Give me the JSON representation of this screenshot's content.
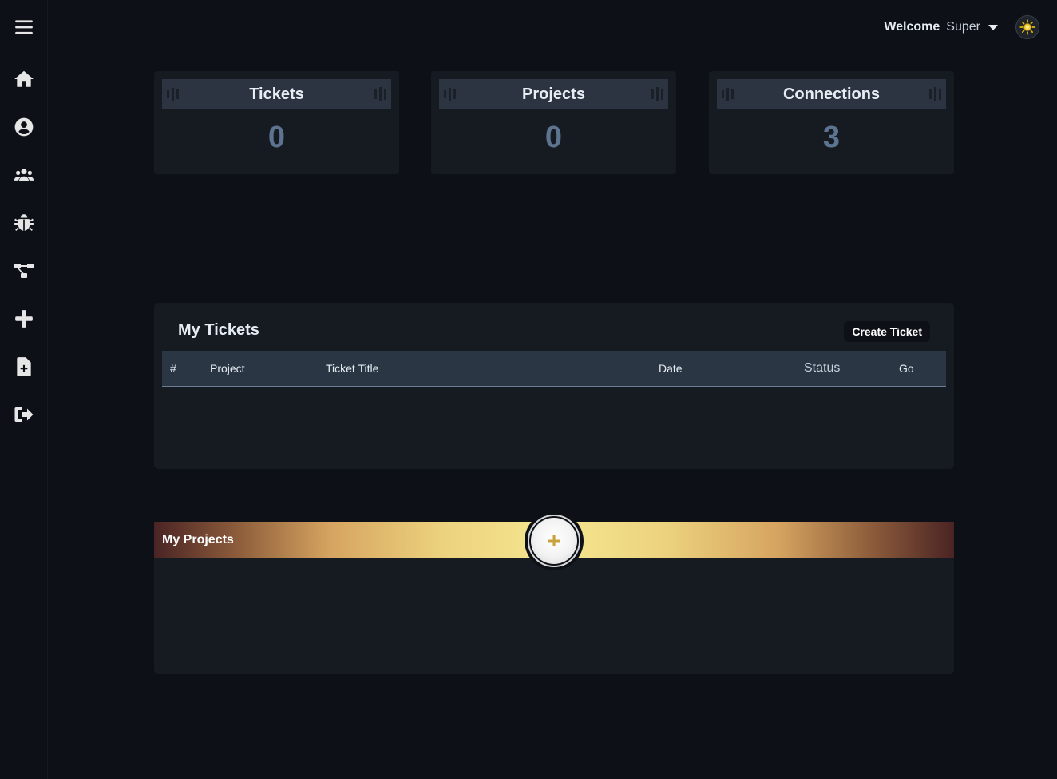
{
  "header": {
    "welcome_label": "Welcome",
    "username": "Super"
  },
  "sidebar": {
    "items": [
      {
        "icon": "menu-icon"
      },
      {
        "icon": "home-icon"
      },
      {
        "icon": "user-circle-icon"
      },
      {
        "icon": "users-icon"
      },
      {
        "icon": "bug-icon"
      },
      {
        "icon": "project-diagram-icon"
      },
      {
        "icon": "plus-icon"
      },
      {
        "icon": "file-add-icon"
      },
      {
        "icon": "sign-out-icon"
      }
    ]
  },
  "stats": [
    {
      "title": "Tickets",
      "value": "0"
    },
    {
      "title": "Projects",
      "value": "0"
    },
    {
      "title": "Connections",
      "value": "3"
    }
  ],
  "tickets": {
    "title": "My Tickets",
    "create_label": "Create Ticket",
    "columns": [
      "#",
      "Project",
      "Ticket Title",
      "Date",
      "Status",
      "Go"
    ]
  },
  "projects": {
    "title": "My Projects",
    "add_symbol": "+"
  },
  "colors": {
    "background": "#0d1117",
    "panel": "#161b22",
    "stat_value": "#5d7490",
    "accent_gold": "#c8a23a"
  }
}
